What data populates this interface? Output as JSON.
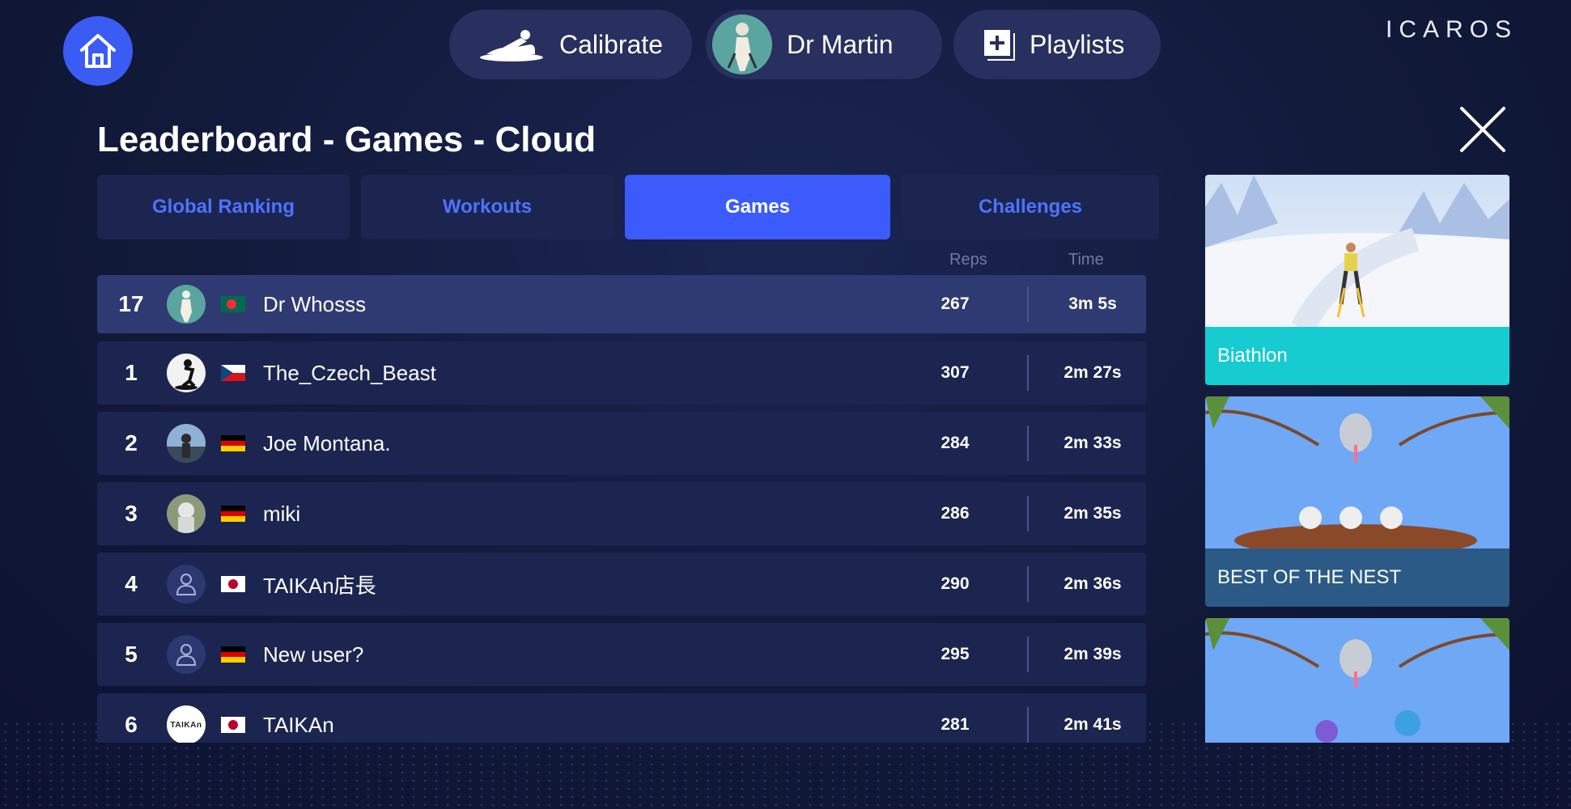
{
  "header": {
    "calibrate_label": "Calibrate",
    "profile_name": "Dr Martin",
    "playlists_label": "Playlists",
    "logo_text": "ICAROS",
    "home_icon": "home-icon",
    "close_icon": "close-icon"
  },
  "page_title": "Leaderboard - Games - Cloud",
  "tabs": [
    {
      "label": "Global Ranking",
      "active": false
    },
    {
      "label": "Workouts",
      "active": false
    },
    {
      "label": "Games",
      "active": true
    },
    {
      "label": "Challenges",
      "active": false
    }
  ],
  "columns": {
    "reps": "Reps",
    "time": "Time"
  },
  "leaderboard": [
    {
      "rank": "17",
      "name": "Dr Whosss",
      "flag": "bangladesh",
      "reps": "267",
      "time": "3m 5s",
      "self": true
    },
    {
      "rank": "1",
      "name": "The_Czech_Beast",
      "flag": "czech",
      "reps": "307",
      "time": "2m 27s"
    },
    {
      "rank": "2",
      "name": "Joe Montana.",
      "flag": "germany",
      "reps": "284",
      "time": "2m 33s"
    },
    {
      "rank": "3",
      "name": "miki",
      "flag": "germany",
      "reps": "286",
      "time": "2m 35s"
    },
    {
      "rank": "4",
      "name": "TAIKAn店長",
      "flag": "japan",
      "reps": "290",
      "time": "2m 36s"
    },
    {
      "rank": "5",
      "name": "New user?",
      "flag": "germany",
      "reps": "295",
      "time": "2m 39s"
    },
    {
      "rank": "6",
      "name": "TAIKAn",
      "flag": "japan",
      "reps": "281",
      "time": "2m 41s"
    }
  ],
  "avatar_badge_text": "TAIKAn",
  "game_cards": [
    {
      "title": "Biathlon",
      "label_color": "#16ccd0"
    },
    {
      "title": "BEST OF THE NEST",
      "label_color": "#2b5a86"
    },
    {
      "title": "",
      "label_color": ""
    }
  ],
  "colors": {
    "accent": "#3b5bfc",
    "tab_text": "#4f72ff"
  }
}
